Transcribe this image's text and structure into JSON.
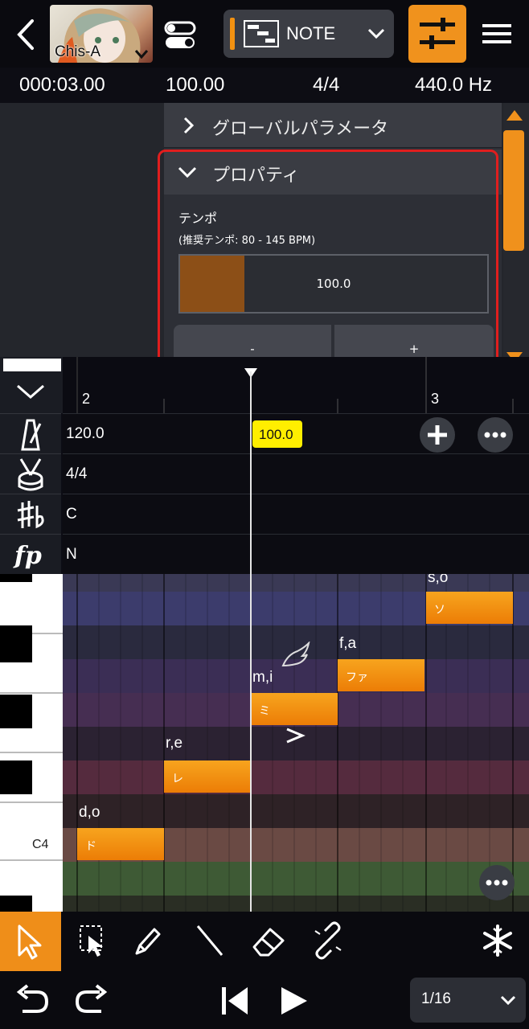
{
  "header": {
    "back_icon": "chevron-left-icon",
    "singer_name": "Chis-A",
    "mode_label": "NOTE",
    "colors": {
      "accent": "#f0921d"
    }
  },
  "status": {
    "time": "000:03.00",
    "tempo": "100.00",
    "meter": "4/4",
    "pitch": "440.0 Hz"
  },
  "panel": {
    "global_params": "グローバルパラメータ",
    "properties": "プロパティ",
    "tempo_label": "テンポ",
    "tempo_hint": "(推奨テンポ: 80 - 145 BPM)",
    "tempo_value": "100.0",
    "tempo_fill_fraction": 0.21,
    "minus_label": "-",
    "plus_label": "+"
  },
  "ruler": {
    "bar_2": "2",
    "bar_3": "3"
  },
  "tracks": {
    "tempo_start": "120.0",
    "tempo_marker": "100.0",
    "meter": "4/4",
    "key": "C",
    "dynamics": "N"
  },
  "piano": {
    "c4_label": "C4"
  },
  "notes": [
    {
      "lyric": "d,o",
      "text": "ド"
    },
    {
      "lyric": "r,e",
      "text": "レ"
    },
    {
      "lyric": "m,i",
      "text": "ミ"
    },
    {
      "lyric": "f,a",
      "text": "ファ"
    },
    {
      "lyric": "s,o",
      "text": "ソ"
    }
  ],
  "bottom": {
    "snap_value": "1/16"
  }
}
